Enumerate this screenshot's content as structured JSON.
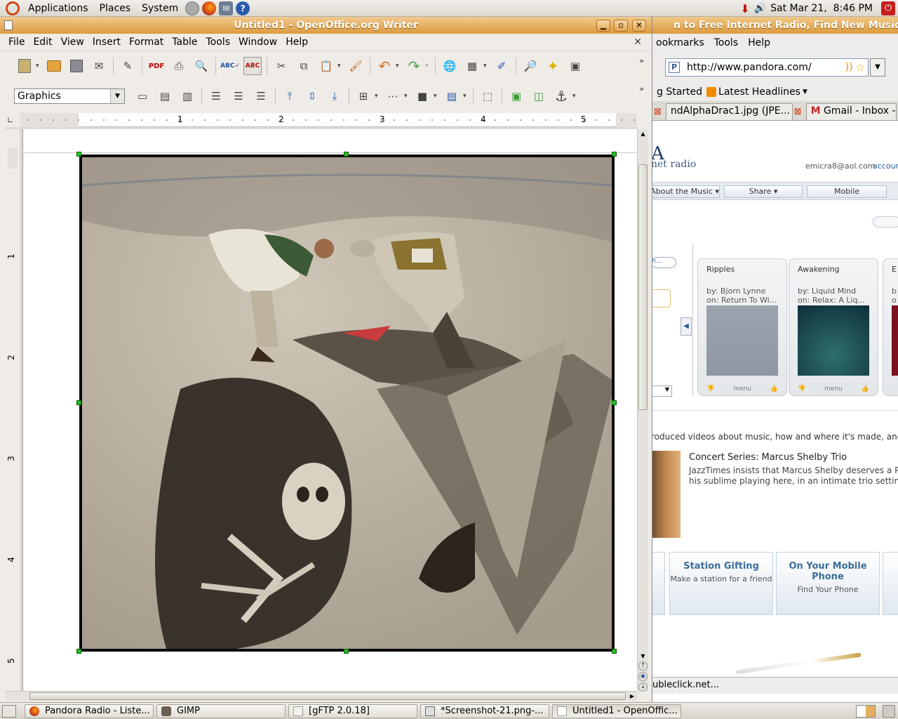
{
  "top_panel": {
    "menus": [
      "Applications",
      "Places",
      "System"
    ],
    "datetime": "Sat Mar 21,  8:46 PM"
  },
  "firefox": {
    "title": "n to Free Internet Radio, Find New Music - Mozil",
    "menu": [
      "ookmarks",
      "Tools",
      "Help"
    ],
    "url": "http://www.pandora.com/",
    "bookmarks": [
      "g Started",
      "Latest Headlines"
    ],
    "tabs": [
      "ndAlphaDrac1.jpg (JPE...",
      "Gmail - Inbox -"
    ],
    "brand_sub": "net radio",
    "account_email": "emicra8@aol.com",
    "account_link": "accoun",
    "nav_buttons": [
      "About the Music",
      "Share",
      "Mobile"
    ],
    "stations": [
      {
        "title": "Ripples",
        "by": "by: Bjorn Lynne",
        "on": "on: Return To Wi..."
      },
      {
        "title": "Awakening",
        "by": "by: Liquid Mind",
        "on": "on: Relax: A Liq..."
      },
      {
        "title": "E",
        "by": "b",
        "on": "o"
      }
    ],
    "card_menu": "menu",
    "promo_text": "roduced videos about music, how and where it's made, and",
    "concert_title": "Concert Series: Marcus Shelby Trio",
    "concert_text1": "JazzTimes insists that Marcus Shelby deserves a Pul",
    "concert_text2": "his sublime playing here, in an intimate trio setting.",
    "promos": [
      {
        "title": "Station Gifting",
        "sub": "Make a station for a friend"
      },
      {
        "title": "On Your Mobile Phone",
        "sub": "Find Your Phone"
      }
    ],
    "status": "ubleclick.net..."
  },
  "writer": {
    "title": "Untitled1 - OpenOffice.org Writer",
    "menu": [
      "File",
      "Edit",
      "View",
      "Insert",
      "Format",
      "Table",
      "Tools",
      "Window",
      "Help"
    ],
    "style_box": "Graphics",
    "hruler_labels": [
      "1",
      "2",
      "3",
      "4",
      "5"
    ],
    "vruler_labels": [
      "1",
      "2",
      "3",
      "4",
      "5"
    ]
  },
  "taskbar": {
    "tasks": [
      "Pandora Radio - Liste...",
      "GIMP",
      "[gFTP 2.0.18]",
      "*Screenshot-21.png-...",
      "Untitled1 - OpenOffic..."
    ]
  }
}
